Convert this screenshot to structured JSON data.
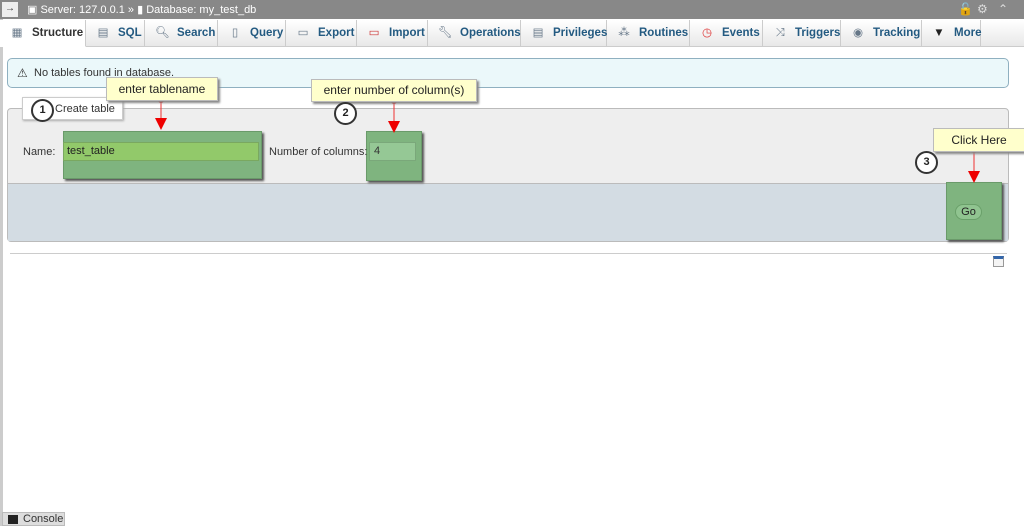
{
  "topbar": {
    "server": "Server: 127.0.0.1",
    "separator": "»",
    "database": "Database: my_test_db"
  },
  "tabs": [
    {
      "label": "Structure",
      "icon": "structure-icon",
      "active": true
    },
    {
      "label": "SQL",
      "icon": "sql-icon"
    },
    {
      "label": "Search",
      "icon": "search-icon"
    },
    {
      "label": "Query",
      "icon": "query-icon"
    },
    {
      "label": "Export",
      "icon": "export-icon"
    },
    {
      "label": "Import",
      "icon": "import-icon"
    },
    {
      "label": "Operations",
      "icon": "wrench-icon"
    },
    {
      "label": "Privileges",
      "icon": "privileges-icon"
    },
    {
      "label": "Routines",
      "icon": "routines-icon"
    },
    {
      "label": "Events",
      "icon": "clock-icon"
    },
    {
      "label": "Triggers",
      "icon": "triggers-icon"
    },
    {
      "label": "Tracking",
      "icon": "eye-icon"
    },
    {
      "label": "More",
      "icon": "caret-down-icon"
    }
  ],
  "notice": "No tables found in database.",
  "create_table": {
    "legend": "Create table",
    "name_label": "Name:",
    "name_value": "test_table",
    "columns_label": "Number of columns:",
    "columns_value": "4",
    "go_label": "Go"
  },
  "callouts": {
    "c1_text": "enter tablename",
    "c1_num": "1",
    "c2_text": "enter number of column(s)",
    "c2_num": "2",
    "c3_text": "Click Here",
    "c3_num": "3",
    "color": "#ff0000"
  },
  "console": "Console"
}
